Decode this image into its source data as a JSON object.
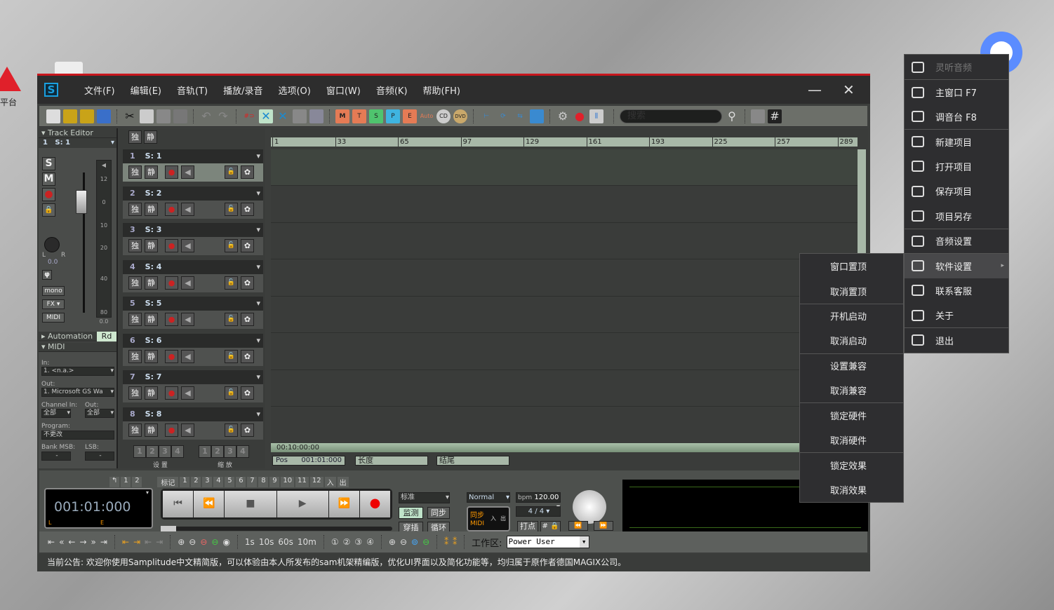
{
  "desktop": {
    "label": "平台"
  },
  "window": {
    "menu": [
      "文件(F)",
      "编辑(E)",
      "音轨(T)",
      "播放/录音",
      "选项(O)",
      "窗口(W)",
      "音频(K)",
      "帮助(FH)"
    ],
    "minimize": "—",
    "close": "✕",
    "logo": "S"
  },
  "toolbar": {
    "search_placeholder": "搜索",
    "badges": [
      "M",
      "T",
      "S",
      "P",
      "E",
      "Auto",
      "CD",
      "DVD"
    ]
  },
  "track_editor": {
    "title": "Track Editor",
    "selected": "1",
    "selected_name": "S: 1",
    "buttons": [
      "S",
      "M"
    ],
    "scale": [
      "12",
      "0",
      "10",
      "20",
      "40",
      "80"
    ],
    "meter_value": "0.0",
    "pan_value": "0.0",
    "pan_l": "L",
    "pan_r": "R",
    "phase": "φ",
    "mono": "mono",
    "fx": "FX",
    "midi": "MIDI"
  },
  "automation": {
    "title": "Automation",
    "mode": "Rd"
  },
  "midi": {
    "title": "MIDI",
    "in_label": "In:",
    "in_value": "1. <n.a.>",
    "out_label": "Out:",
    "out_value": "1. Microsoft GS Wa",
    "channel_in_label": "Channel In:",
    "channel_in_value": "全部",
    "channel_out_label": "Out:",
    "channel_out_value": "全部",
    "program_label": "Program:",
    "program_value": "不更改",
    "bank_label": "Bank MSB:",
    "bank_value": "-",
    "lsb_label": "LSB:",
    "lsb_value": "-"
  },
  "track_header": {
    "solo": "独",
    "mute": "静"
  },
  "tracks": [
    {
      "num": "1",
      "name": "S: 1"
    },
    {
      "num": "2",
      "name": "S: 2"
    },
    {
      "num": "3",
      "name": "S: 3"
    },
    {
      "num": "4",
      "name": "S: 4"
    },
    {
      "num": "5",
      "name": "S: 5"
    },
    {
      "num": "6",
      "name": "S: 6"
    },
    {
      "num": "7",
      "name": "S: 7"
    },
    {
      "num": "8",
      "name": "S: 8"
    }
  ],
  "presets": {
    "setup_label": "设 置",
    "zoom_label": "缩 放",
    "numbers": [
      "1",
      "2",
      "3",
      "4"
    ]
  },
  "ruler": [
    "1",
    "33",
    "65",
    "97",
    "129",
    "161",
    "193",
    "225",
    "257",
    "289"
  ],
  "timeline": {
    "time": "00:10:00:00",
    "pos_label": "Pos",
    "pos_value": "001:01:000",
    "length_label": "长度",
    "end_label": "结尾"
  },
  "transport": {
    "time": "001:01:000",
    "l": "L",
    "e": "E",
    "marker_label": "标记",
    "markers": [
      "1",
      "2",
      "3",
      "4",
      "5",
      "6",
      "7",
      "8",
      "9",
      "10",
      "11",
      "12"
    ],
    "loop_nums": [
      "1",
      "2"
    ],
    "in": "入",
    "out": "出",
    "mode": "标准",
    "monitor": "监测",
    "sync": "同步",
    "punch": "穿插",
    "loop": "循环",
    "normal": "Normal",
    "bpm_label": "bpm",
    "bpm": "120.00",
    "signature": "4 / 4",
    "sync_midi_sync": "同步",
    "sync_midi_midi": "MIDI",
    "sync_in": "入",
    "sync_out": "出",
    "tap": "打点"
  },
  "bottombar": {
    "time_buttons": [
      "1s",
      "10s",
      "60s",
      "10m"
    ],
    "workspace_label": "工作区:",
    "workspace_value": "Power User"
  },
  "status": "当前公告: 欢迎你使用Samplitude中文精简版，可以体验由本人所发布的sam机架精编版，优化UI界面以及简化功能等，均归属于原作者德国MAGIX公司。",
  "tray_menu": [
    {
      "label": "灵听音频",
      "disabled": true,
      "icon": "speaker-icon"
    },
    {
      "label": "主窗口  F7",
      "icon": "window-icon"
    },
    {
      "label": "调音台  F8",
      "icon": "mixer-icon"
    },
    {
      "label": "新建项目",
      "icon": "new-folder-icon"
    },
    {
      "label": "打开项目",
      "icon": "open-folder-icon"
    },
    {
      "label": "保存项目",
      "icon": "save-icon"
    },
    {
      "label": "项目另存",
      "icon": "save-as-icon"
    },
    {
      "label": "音频设置",
      "icon": "audio-settings-icon"
    },
    {
      "label": "软件设置",
      "icon": "cube-icon",
      "highlighted": true
    },
    {
      "label": "联系客服",
      "icon": "headset-icon"
    },
    {
      "label": "关于",
      "icon": "info-icon"
    },
    {
      "label": "退出",
      "icon": "power-icon"
    }
  ],
  "submenu": [
    "窗口置顶",
    "取消置顶",
    "开机启动",
    "取消启动",
    "设置兼容",
    "取消兼容",
    "锁定硬件",
    "取消硬件",
    "锁定效果",
    "取消效果"
  ]
}
